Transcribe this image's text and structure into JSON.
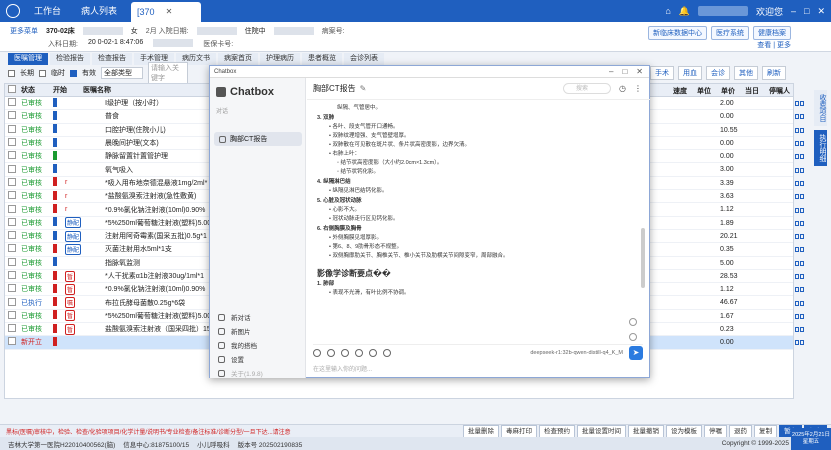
{
  "topbar": {
    "tab_workbench": "工作台",
    "tab_patients": "病人列表",
    "tab_current": "[370",
    "user_hint": "欢迎您"
  },
  "patient": {
    "more": "更多菜单",
    "bed": "370-02床",
    "sex": "女",
    "admit_age": "2月 入院日期:",
    "admit_date_label": "入科日期:",
    "admit_date": "20  0-02-1  8:47:06",
    "diag_label": "病案号:",
    "live_label": "住院中",
    "card_label": "医保卡号:",
    "btn_new": "新临床数据中心",
    "btn_sys": "医疗系统",
    "btn_health": "健康档案",
    "link_right": "查看 | 更多"
  },
  "modtabs": [
    "医嘱管理",
    "检验报告",
    "检查报告",
    "手术管理",
    "病历文书",
    "病案首页",
    "护理病历",
    "患者概览",
    "会诊列表"
  ],
  "filter": {
    "longterm": "长期",
    "temp": "临时",
    "valid": "有效",
    "type": "全部类型",
    "placeholder": "请输入关键字"
  },
  "rtool": [
    "手术",
    "用血",
    "会诊",
    "其他",
    "刷新"
  ],
  "table": {
    "headers": {
      "state": "状态",
      "flag": "开始",
      "name": "医嘱名称",
      "speed": "速度",
      "unit": "单位",
      "price": "单价",
      "today": "当日",
      "nurse": "停嘱人"
    },
    "rows": [
      {
        "state": "已审核",
        "flag": "#1f5fbf",
        "mark": "",
        "name": "Ⅰ级护理（按小时）",
        "price": "2.00"
      },
      {
        "state": "已审核",
        "flag": "#1f5fbf",
        "mark": "",
        "name": "普食",
        "price": "0.00"
      },
      {
        "state": "已审核",
        "flag": "#1f5fbf",
        "mark": "",
        "name": "口腔护理(住院小儿)",
        "price": "10.55"
      },
      {
        "state": "已审核",
        "flag": "#1f5fbf",
        "mark": "",
        "name": "晨晚间护理(文本)",
        "price": "0.00"
      },
      {
        "state": "已审核",
        "flag": "#1a9a30",
        "mark": "",
        "name": "静脉留置针置管护理",
        "price": "0.00"
      },
      {
        "state": "已审核",
        "flag": "#1f5fbf",
        "mark": "",
        "name": "氧气吸入",
        "price": "3.00"
      },
      {
        "state": "已审核",
        "flag": "#d02020",
        "mark": "r",
        "name": "*吸入用布地奈德混悬液1mg/2ml*",
        "price": "3.39"
      },
      {
        "state": "已审核",
        "flag": "#d02020",
        "mark": "r",
        "name": "*盐酸氨溴索注射液(急性敷黄)",
        "price": "3.63"
      },
      {
        "state": "已审核",
        "flag": "#d02020",
        "mark": "r",
        "name": "*0.9%氯化钠注射液(10ml)0.90%",
        "price": "1.12"
      },
      {
        "state": "已审核",
        "flag": "#1f5fbf",
        "mark": "tag",
        "name": "*5%250ml葡萄糖注射液(塑料)5.00",
        "price": "1.89"
      },
      {
        "state": "已审核",
        "flag": "#1f5fbf",
        "mark": "tag",
        "name": "注射用阿奇霉素(国采五批)0.5g*1",
        "price": "20.21"
      },
      {
        "state": "已审核",
        "flag": "#d02020",
        "mark": "tag",
        "name": "灭菌注射用水5ml*1支",
        "price": "0.35"
      },
      {
        "state": "已审核",
        "flag": "#1f5fbf",
        "mark": "",
        "name": "指脉氧监测",
        "price": "5.00"
      },
      {
        "state": "已审核",
        "flag": "#d02020",
        "mark": "暂",
        "name": "*人干扰素α1b注射液30ug/1ml*1",
        "price": "28.53"
      },
      {
        "state": "已审核",
        "flag": "#d02020",
        "mark": "暂",
        "name": "*0.9%氯化钠注射液(10ml)0.90%",
        "price": "1.12"
      },
      {
        "state": "已执行",
        "flag": "#d02020",
        "mark": "嘱",
        "name": "布拉氏酵母菌散0.25g*6袋",
        "price": "46.67"
      },
      {
        "state": "已审核",
        "flag": "#d02020",
        "mark": "暂",
        "name": "*5%250ml葡萄糖注射液(塑料)5.00%",
        "price": "1.67"
      },
      {
        "state": "已审核",
        "flag": "#d02020",
        "mark": "暂",
        "name": "盐酸氨溴索注射液（国采四批）15",
        "price": "0.23"
      },
      {
        "state": "新开立",
        "flag": "#d02020",
        "mark": "",
        "name": "",
        "price": "0.00"
      }
    ]
  },
  "sidetabs": [
    "收费项目",
    "执行明细"
  ],
  "chat": {
    "win_title": "Chatbox",
    "brand": "Chatbox",
    "search": "对话",
    "conv": "胸部CT报告",
    "title": "胸部CT报告",
    "search_ph": "搜索",
    "menu": [
      "新对话",
      "新图片",
      "我的搭档",
      "设置",
      "关于(1.9.8)"
    ],
    "body": [
      {
        "t": "li2",
        "v": "纵隔、气管居中。"
      },
      {
        "t": "h",
        "v": "3. 双肺"
      },
      {
        "t": "li",
        "v": "• 各叶、段支气管开口通畅。"
      },
      {
        "t": "li",
        "v": "• 双肺纹理增强、支气管壁增厚。"
      },
      {
        "t": "li",
        "v": "• 双肺散在可见散在斑片状、条片状高密度影，边界欠清。"
      },
      {
        "t": "li",
        "v": "• 右肺上叶："
      },
      {
        "t": "li2",
        "v": "◦ 结节状高密度影（大小约2.0cm×1.3cm）。"
      },
      {
        "t": "li2",
        "v": "◦ 结节状钙化影。"
      },
      {
        "t": "h",
        "v": "4. 纵隔淋巴结"
      },
      {
        "t": "li",
        "v": "• 纵隔见淋巴结钙化影。"
      },
      {
        "t": "h",
        "v": "5. 心脏及冠状动脉"
      },
      {
        "t": "li",
        "v": "• 心影不大。"
      },
      {
        "t": "li",
        "v": "• 冠状动脉走行区见钙化影。"
      },
      {
        "t": "h",
        "v": "6. 右侧胸膜及胸骨"
      },
      {
        "t": "li",
        "v": "• 外侧胸膜见增厚影。"
      },
      {
        "t": "li",
        "v": "• 第6、8、9肋骨形态不规整。"
      },
      {
        "t": "li",
        "v": "• 双侧胸廓肋关节、胸椎关节、椎小关节及肋横关节间隙变窄，周部融合。"
      },
      {
        "t": "big",
        "v": "影像学诊断要点��"
      },
      {
        "t": "h",
        "v": "1. 肺部"
      },
      {
        "t": "li",
        "v": "• 表现不光滑，有叶比例不协调。"
      }
    ],
    "model": "deepseek-r1:32b-qwen-distill-q4_K_M",
    "input_ph": "在这里输入你的问题..."
  },
  "bottom": {
    "warn": "黑标(医嘱)审核中，检验、检查/化验项项目/化学计量/说明书/专业检查/备注标准/诊断分型/一旦下达...请注意",
    "btns": [
      "批量删除",
      "毒麻打印",
      "检查预约",
      "批量设置时间",
      "批量撤销",
      "设为模板",
      "停嘱",
      "退药",
      "复制",
      "暂存",
      "保存"
    ]
  },
  "status": {
    "hospital": "吉林大学第一医院H22010400562(脑)",
    "info": "信息中心:81875100/15",
    "dept": "小儿呼吸科",
    "ver": "版本号 202502190835",
    "copy": "Copyright © 1999-2025"
  },
  "clock": {
    "date": "2025年2月21日",
    "day": "星期五"
  }
}
